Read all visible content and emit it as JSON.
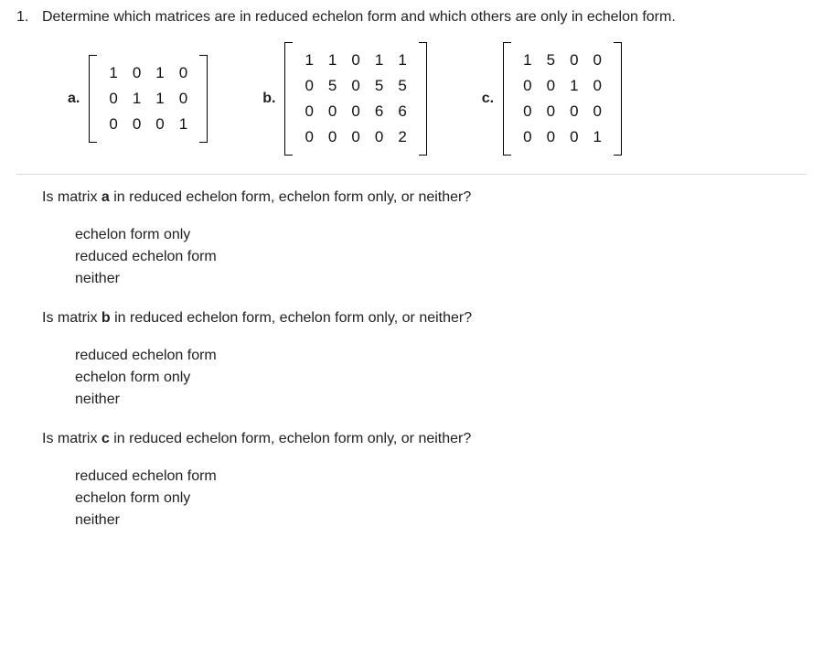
{
  "question_number": "1.",
  "prompt": "Determine which matrices are in reduced echelon form and which others are only in echelon form.",
  "matrices": [
    {
      "label": "a.",
      "rows": [
        [
          "1",
          "0",
          "1",
          "0"
        ],
        [
          "0",
          "1",
          "1",
          "0"
        ],
        [
          "0",
          "0",
          "0",
          "1"
        ]
      ]
    },
    {
      "label": "b.",
      "rows": [
        [
          "1",
          "1",
          "0",
          "1",
          "1"
        ],
        [
          "0",
          "5",
          "0",
          "5",
          "5"
        ],
        [
          "0",
          "0",
          "0",
          "6",
          "6"
        ],
        [
          "0",
          "0",
          "0",
          "0",
          "2"
        ]
      ]
    },
    {
      "label": "c.",
      "rows": [
        [
          "1",
          "5",
          "0",
          "0"
        ],
        [
          "0",
          "0",
          "1",
          "0"
        ],
        [
          "0",
          "0",
          "0",
          "0"
        ],
        [
          "0",
          "0",
          "0",
          "1"
        ]
      ]
    }
  ],
  "parts": [
    {
      "question_pre": "Is matrix ",
      "bold": "a",
      "question_post": " in reduced echelon form, echelon form only, or neither?",
      "options": [
        "echelon form only",
        "reduced echelon form",
        "neither"
      ]
    },
    {
      "question_pre": "Is matrix ",
      "bold": "b",
      "question_post": " in reduced echelon form, echelon form only, or neither?",
      "options": [
        "reduced echelon form",
        "echelon form only",
        "neither"
      ]
    },
    {
      "question_pre": "Is matrix ",
      "bold": "c",
      "question_post": " in reduced echelon form, echelon form only, or neither?",
      "options": [
        "reduced echelon form",
        "echelon form only",
        "neither"
      ]
    }
  ]
}
